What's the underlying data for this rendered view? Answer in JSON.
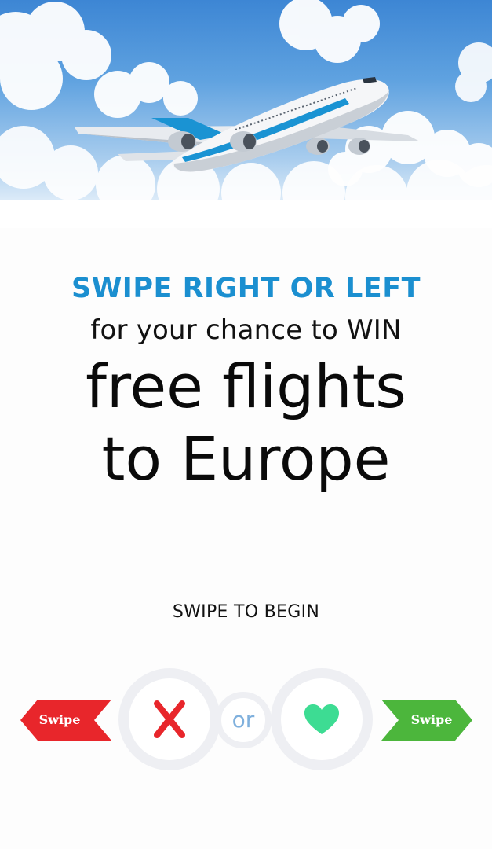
{
  "headline": {
    "kicker": "SWIPE RIGHT OR LEFT",
    "subline": "for your chance to WIN",
    "line1": "free flights",
    "line2": "to Europe"
  },
  "cta": {
    "label": "SWIPE TO BEGIN"
  },
  "controls": {
    "left_arrow_label": "Swipe",
    "right_arrow_label": "Swipe",
    "or_label": "or",
    "nope_icon": "x-icon",
    "like_icon": "heart-icon"
  },
  "colors": {
    "kicker": "#1b8fd0",
    "nope": "#e8262b",
    "like": "#3ddc93",
    "left_arrow": "#e8262b",
    "right_arrow": "#4cb63c",
    "ring": "#eeeff3",
    "or_text": "#7fb0dd"
  }
}
